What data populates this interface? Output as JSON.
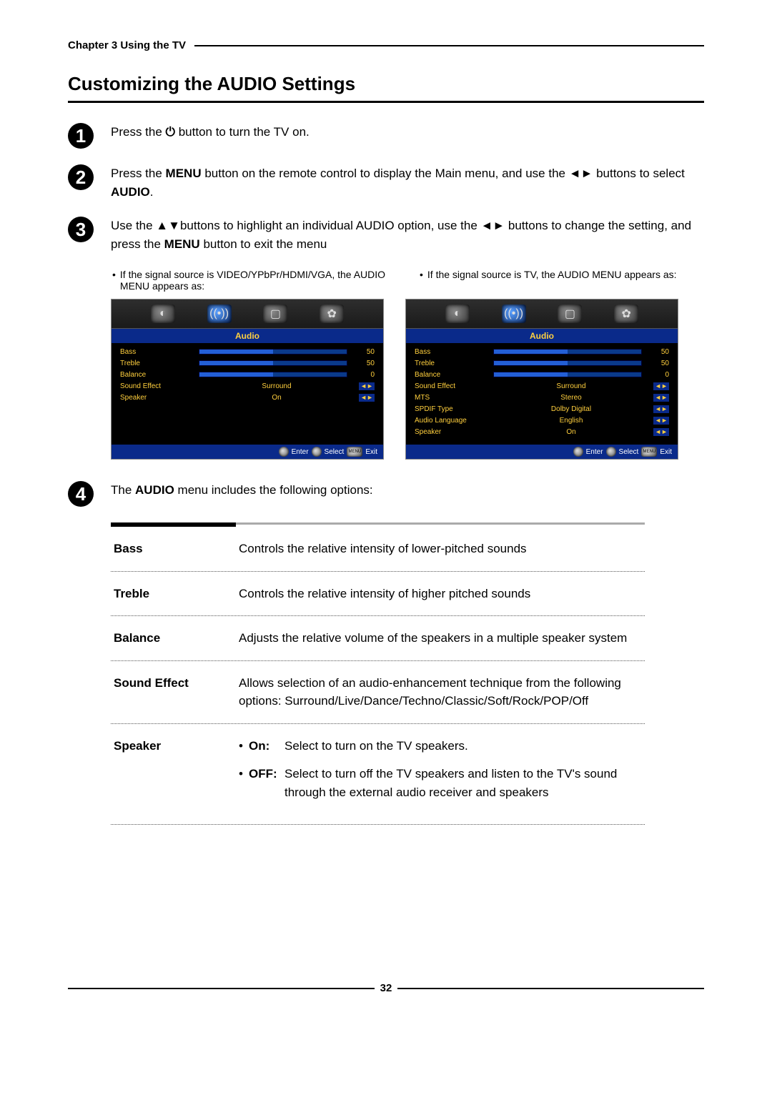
{
  "header": {
    "chapter": "Chapter 3 Using the TV"
  },
  "title": "Customizing the AUDIO Settings",
  "steps": {
    "s1": {
      "num": "1",
      "pre": "Press the ",
      "post": " button to turn the TV on."
    },
    "s2": {
      "num": "2",
      "pre": "Press the ",
      "menu": "MENU",
      "mid": " button on the remote control to display the Main menu, and use the ◄► buttons to select ",
      "audio": "AUDIO",
      "end": "."
    },
    "s3": {
      "num": "3",
      "line": "Use the ▲▼buttons to highlight an individual AUDIO option, use the ◄► buttons to change the setting, and press the ",
      "menu": "MENU",
      "end": " button to exit the menu"
    },
    "s4": {
      "num": "4",
      "pre": "The ",
      "audio": "AUDIO",
      "post": " menu includes the following options:"
    }
  },
  "notes": {
    "left": "If the signal source is VIDEO/YPbPr/HDMI/VGA, the AUDIO MENU appears as:",
    "right": "If the signal source is TV, the AUDIO MENU appears as:"
  },
  "osd_left": {
    "title": "Audio",
    "rows": [
      {
        "label": "Bass",
        "type": "slider",
        "fill": 50,
        "val": "50"
      },
      {
        "label": "Treble",
        "type": "slider",
        "fill": 50,
        "val": "50"
      },
      {
        "label": "Balance",
        "type": "slider",
        "fill": 50,
        "val": "0"
      },
      {
        "label": "Sound Effect",
        "type": "select",
        "val": "Surround"
      },
      {
        "label": "Speaker",
        "type": "select",
        "val": "On"
      }
    ],
    "footer": {
      "enter": "Enter",
      "select": "Select",
      "menu": "MENU",
      "exit": "Exit"
    }
  },
  "osd_right": {
    "title": "Audio",
    "rows": [
      {
        "label": "Bass",
        "type": "slider",
        "fill": 50,
        "val": "50"
      },
      {
        "label": "Treble",
        "type": "slider",
        "fill": 50,
        "val": "50"
      },
      {
        "label": "Balance",
        "type": "slider",
        "fill": 50,
        "val": "0"
      },
      {
        "label": "Sound Effect",
        "type": "select",
        "val": "Surround"
      },
      {
        "label": "MTS",
        "type": "select",
        "val": "Stereo"
      },
      {
        "label": "SPDIF Type",
        "type": "select",
        "val": "Dolby Digital"
      },
      {
        "label": "Audio Language",
        "type": "select",
        "val": "English"
      },
      {
        "label": "Speaker",
        "type": "select",
        "val": "On"
      }
    ],
    "footer": {
      "enter": "Enter",
      "select": "Select",
      "menu": "MENU",
      "exit": "Exit"
    }
  },
  "options": [
    {
      "name": "Bass",
      "desc": "Controls the relative intensity of lower-pitched sounds"
    },
    {
      "name": "Treble",
      "desc": "Controls the relative intensity of higher pitched sounds"
    },
    {
      "name": "Balance",
      "desc": "Adjusts the relative volume of the speakers in a multiple speaker system"
    },
    {
      "name": "Sound Effect",
      "desc": "Allows selection of an audio-enhancement technique from the following options: Surround/Live/Dance/Techno/Classic/Soft/Rock/POP/Off"
    },
    {
      "name": "Speaker",
      "sub": [
        {
          "key": "On:",
          "val": "Select to turn on the TV speakers."
        },
        {
          "key": "OFF:",
          "val": "Select to turn off the TV speakers and listen to the TV's sound through the external audio receiver and speakers"
        }
      ]
    }
  ],
  "page_number": "32"
}
